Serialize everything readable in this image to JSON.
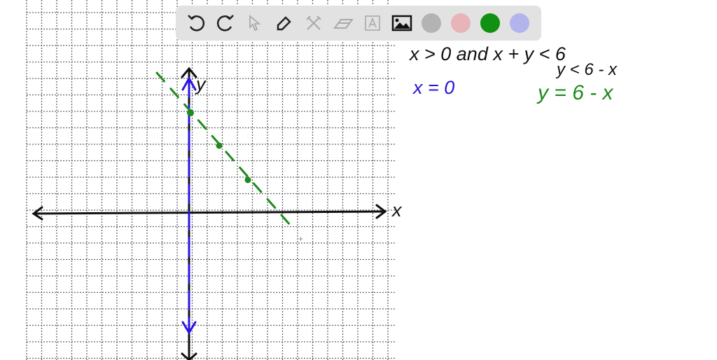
{
  "toolbar": {
    "tools": [
      "undo-icon",
      "redo-icon",
      "select-icon",
      "pen-icon",
      "tools-icon",
      "eraser-icon",
      "text-icon",
      "image-icon"
    ],
    "colors": [
      "#b3b3b3",
      "#e8b4b8",
      "#119111",
      "#b3b3ee"
    ],
    "selected_color": "#119111"
  },
  "canvas": {
    "statement": "x > 0 and x + y < 6",
    "rewrite": "y < 6 - x",
    "line1": "x = 0",
    "line2": "y = 6 - x",
    "x_axis_label": "x",
    "y_axis_label": "y",
    "ink_black": "#111111",
    "ink_blue": "#2a14e0",
    "ink_green": "#1d8a1d"
  }
}
